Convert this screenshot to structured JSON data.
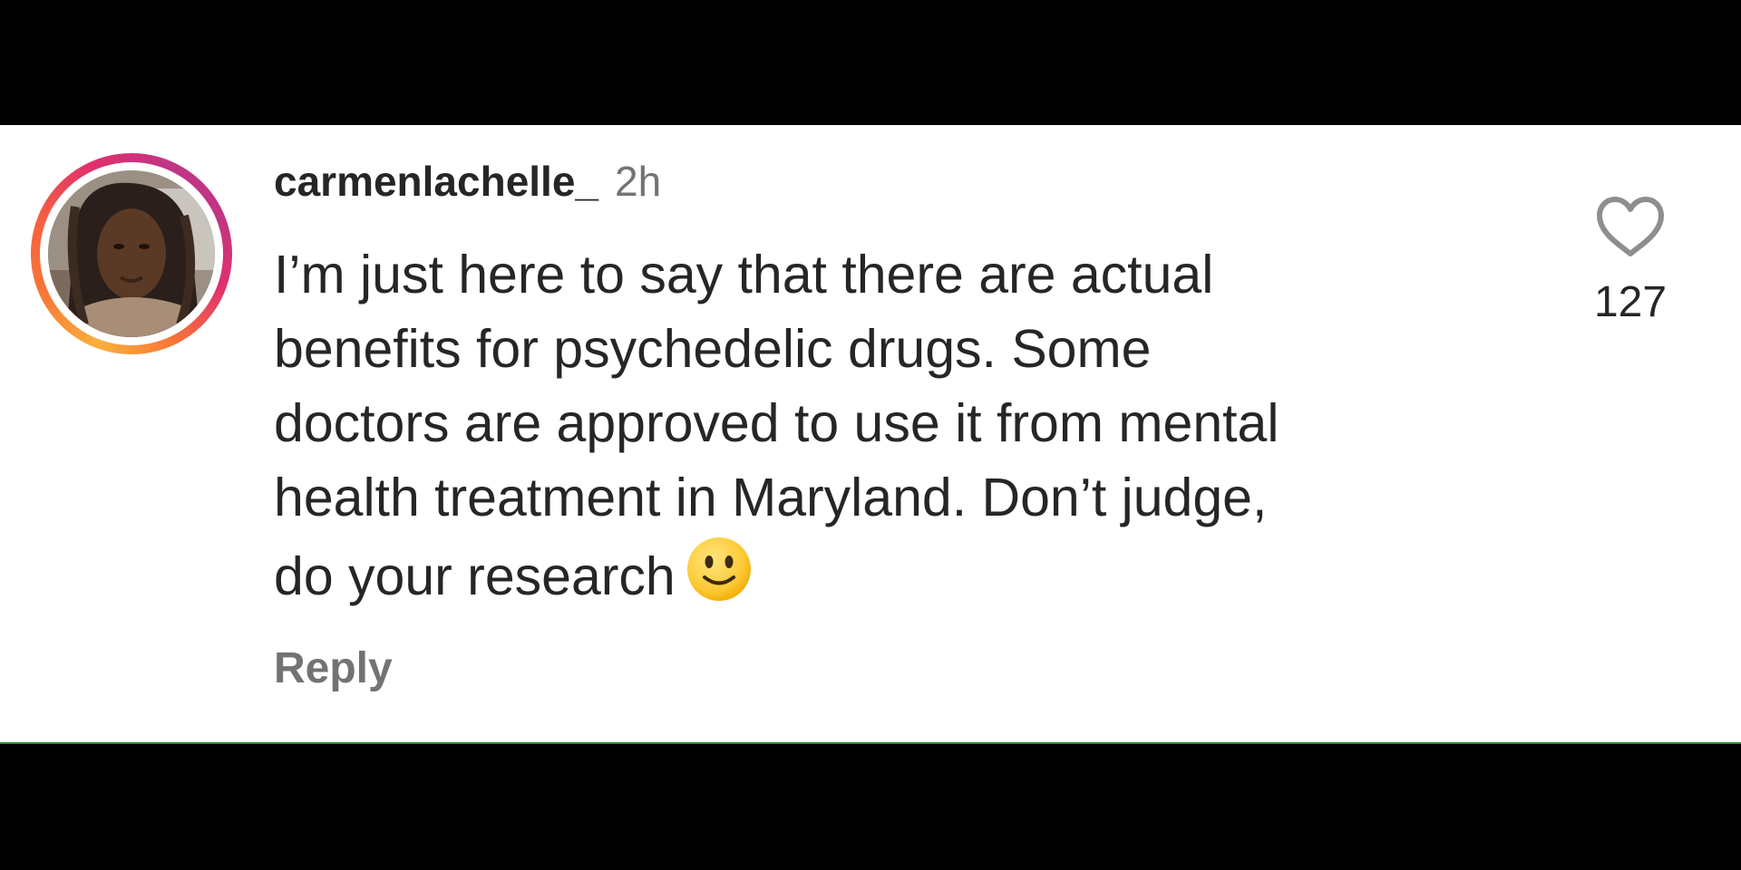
{
  "comment": {
    "username": "carmenlachelle_",
    "timestamp": "2h",
    "text_lines": [
      "I’m just here to say that there are actual",
      "benefits for psychedelic drugs. Some",
      "doctors are approved to use it from mental",
      "health treatment in Maryland. Don’t judge,",
      "do your research"
    ],
    "emoji": "slightly-smiling-face-emoji",
    "reply_label": "Reply",
    "like_count": "127",
    "like_icon": "heart-outline-icon"
  },
  "colors": {
    "background": "#ffffff",
    "letterbox": "#000000",
    "text_primary": "#262626",
    "text_secondary": "#737373",
    "story_ring_gradient": [
      "#fbb03b",
      "#f77737",
      "#e1306c",
      "#c13584"
    ]
  }
}
